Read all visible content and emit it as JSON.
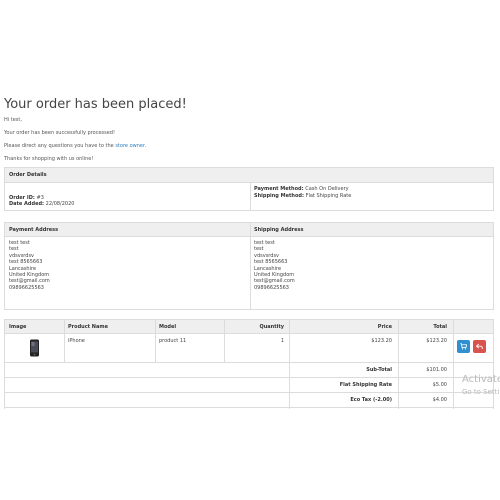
{
  "page": {
    "title": "Your order has been placed!",
    "greeting": "Hi test,",
    "line_processed": "Your order has been successfully processed!",
    "line_questions_prefix": "Please direct any questions you have to the",
    "line_questions_link": "store owner",
    "line_questions_suffix": ".",
    "line_thanks": "Thanks for shopping with us online!"
  },
  "order_details": {
    "header": "Order Details",
    "order_id_label": "Order ID:",
    "order_id": "#3",
    "date_added_label": "Date Added:",
    "date_added": "22/08/2020",
    "payment_method_label": "Payment Method:",
    "payment_method": "Cash On Delivery",
    "shipping_method_label": "Shipping Method:",
    "shipping_method": "Flat Shipping Rate"
  },
  "addresses": {
    "payment_header": "Payment Address",
    "shipping_header": "Shipping Address",
    "payment_lines": [
      "test test",
      "test",
      "vdsvsrdsv",
      "test 8565663",
      "Lancashire",
      "United Kingdom",
      "test@gmail.com",
      "09896625563"
    ],
    "shipping_lines": [
      "test test",
      "test",
      "vdsvsrdsv",
      "test 8565663",
      "Lancashire",
      "United Kingdom",
      "test@gmail.com",
      "09896625563"
    ]
  },
  "products": {
    "headers": {
      "image": "Image",
      "name": "Product Name",
      "model": "Model",
      "quantity": "Quantity",
      "price": "Price",
      "total": "Total"
    },
    "rows": [
      {
        "image_icon": "phone-icon",
        "name": "iPhone",
        "model": "product 11",
        "quantity": "1",
        "price": "$123.20",
        "total": "$123.20"
      }
    ],
    "totals": [
      {
        "label": "Sub-Total",
        "value": "$101.00"
      },
      {
        "label": "Flat Shipping Rate",
        "value": "$5.00"
      },
      {
        "label": "Eco Tax (-2.00)",
        "value": "$4.00"
      }
    ],
    "reorder_icon": "cart-icon",
    "return_icon": "reply-icon",
    "accent_blue": "#2f8fd0",
    "accent_red": "#d9534f"
  },
  "watermark": {
    "line1": "Activate",
    "line2": "Go to Setti"
  }
}
